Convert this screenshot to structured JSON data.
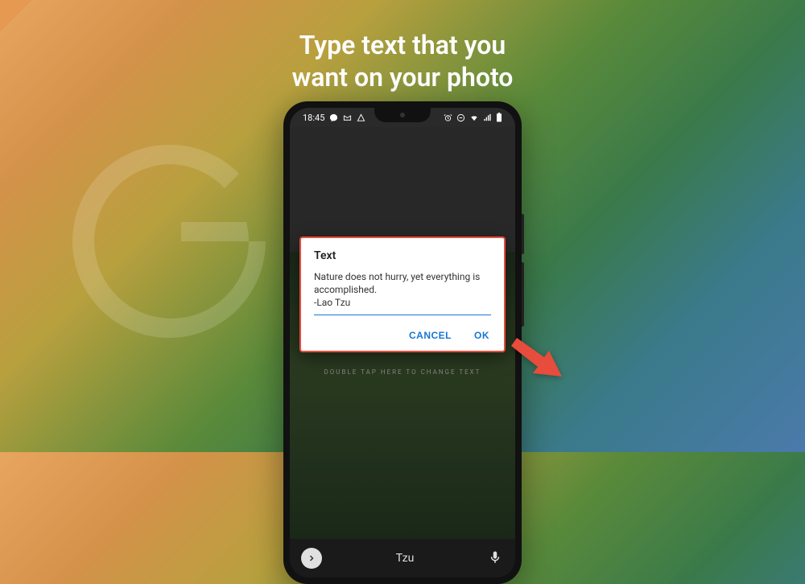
{
  "headline": {
    "line1": "Type text that you",
    "line2": "want on your photo"
  },
  "status": {
    "time": "18:45"
  },
  "dialog": {
    "title": "Text",
    "input_value": "Nature does not hurry, yet everything is accomplished.\n-Lao Tzu",
    "cancel_label": "CANCEL",
    "ok_label": "OK"
  },
  "photo_hint": "DOUBLE TAP HERE TO CHANGE TEXT",
  "keyboard": {
    "suggestion": "Tzu"
  }
}
